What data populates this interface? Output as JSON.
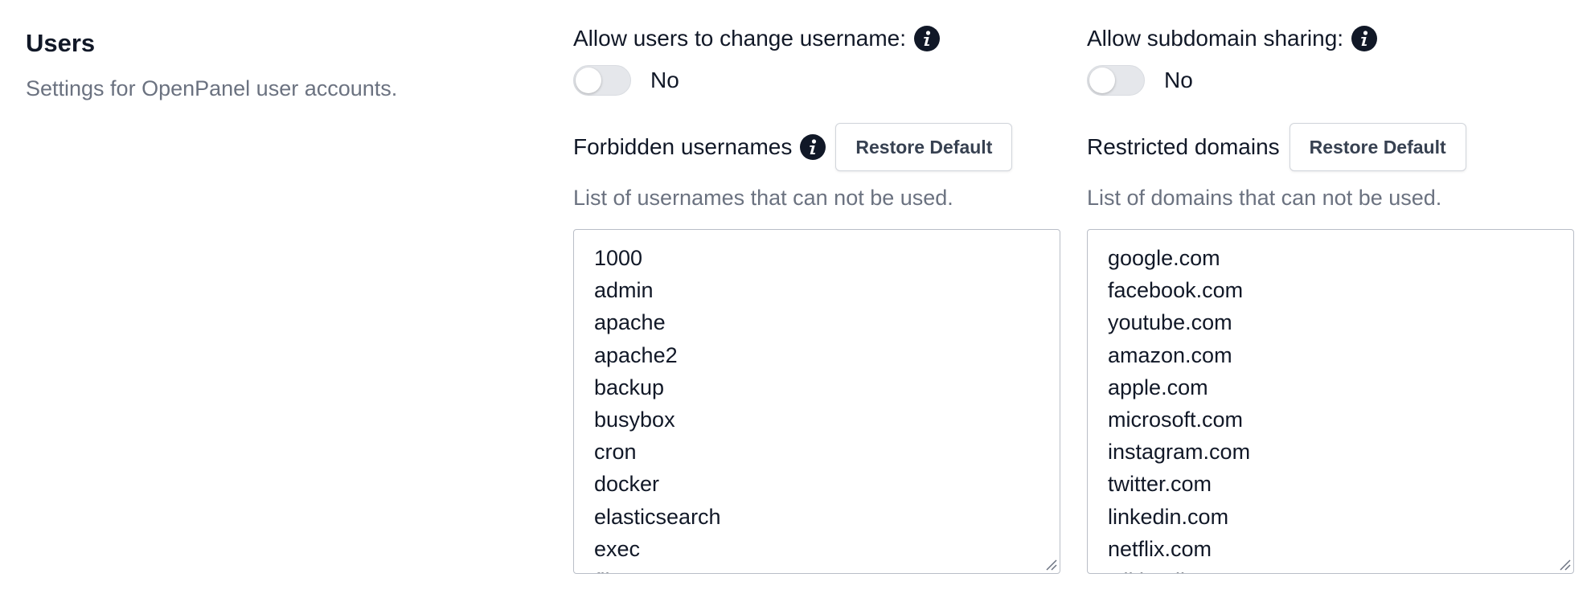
{
  "section": {
    "title": "Users",
    "description": "Settings for OpenPanel user accounts."
  },
  "change_username": {
    "label": "Allow users to change username:",
    "state": "No",
    "enabled": false
  },
  "subdomain_sharing": {
    "label": "Allow subdomain sharing:",
    "state": "No",
    "enabled": false
  },
  "forbidden_usernames": {
    "label": "Forbidden usernames",
    "button": "Restore Default",
    "help": "List of usernames that can not be used.",
    "items": [
      "1000",
      "admin",
      "apache",
      "apache2",
      "backup",
      "busybox",
      "cron",
      "docker",
      "elasticsearch",
      "exec",
      "file"
    ]
  },
  "restricted_domains": {
    "label": "Restricted domains",
    "button": "Restore Default",
    "help": "List of domains that can not be used.",
    "items": [
      "google.com",
      "facebook.com",
      "youtube.com",
      "amazon.com",
      "apple.com",
      "microsoft.com",
      "instagram.com",
      "twitter.com",
      "linkedin.com",
      "netflix.com",
      "wikipedia.org"
    ]
  },
  "colors": {
    "text": "#111827",
    "muted": "#6b7280",
    "toggle_off": "#e5e7eb"
  }
}
